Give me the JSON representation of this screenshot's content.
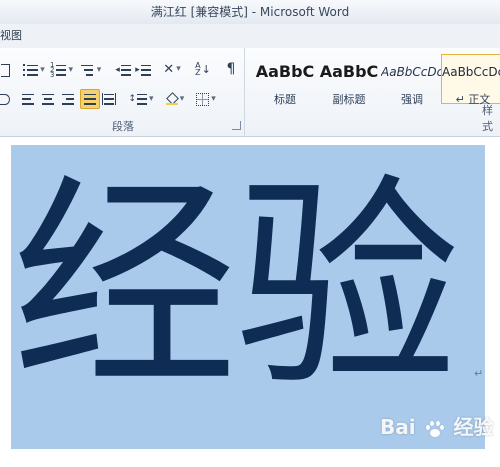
{
  "window": {
    "title": "满江红 [兼容模式] - Microsoft Word"
  },
  "menu": {
    "partial_tab": "视图"
  },
  "ribbon": {
    "paragraph_group": {
      "label": "段落",
      "buttons": [
        {
          "name": "bullets-button",
          "icon": "bullets-icon"
        },
        {
          "name": "numbering-button",
          "icon": "numbering-icon"
        },
        {
          "name": "multilevel-list-button",
          "icon": "multilevel-list-icon"
        },
        {
          "name": "decrease-indent-button",
          "icon": "decrease-indent-icon"
        },
        {
          "name": "increase-indent-button",
          "icon": "increase-indent-icon"
        },
        {
          "name": "chinese-layout-button",
          "icon": "chinese-layout-icon"
        },
        {
          "name": "sort-button",
          "icon": "sort-icon"
        },
        {
          "name": "show-marks-button",
          "icon": "pilcrow-icon"
        },
        {
          "name": "align-left-button",
          "icon": "align-left-icon"
        },
        {
          "name": "center-button",
          "icon": "align-center-icon"
        },
        {
          "name": "align-right-button",
          "icon": "align-right-icon"
        },
        {
          "name": "justify-button",
          "icon": "justify-icon",
          "active": true
        },
        {
          "name": "distributed-button",
          "icon": "distributed-icon"
        },
        {
          "name": "line-spacing-button",
          "icon": "line-spacing-icon"
        },
        {
          "name": "shading-button",
          "icon": "shading-icon"
        },
        {
          "name": "borders-button",
          "icon": "borders-icon"
        }
      ]
    },
    "styles_group": {
      "label_partial": "样式",
      "items": [
        {
          "sample": "AaBbC",
          "name": "标题",
          "selected": false
        },
        {
          "sample": "AaBbC",
          "name": "副标题",
          "selected": false
        },
        {
          "sample": "AaBbCcDc",
          "name": "强调",
          "selected": false
        },
        {
          "sample": "AaBbCcDc",
          "name": "↵ 正文",
          "selected": true
        }
      ]
    }
  },
  "document": {
    "text": "经验",
    "highlight_color": "#aacaeb",
    "text_color": "#0f2c55",
    "paragraph_mark": "↵"
  },
  "watermark": {
    "text": "Bai 经验",
    "prefix": "Bai",
    "suffix": "经验"
  }
}
